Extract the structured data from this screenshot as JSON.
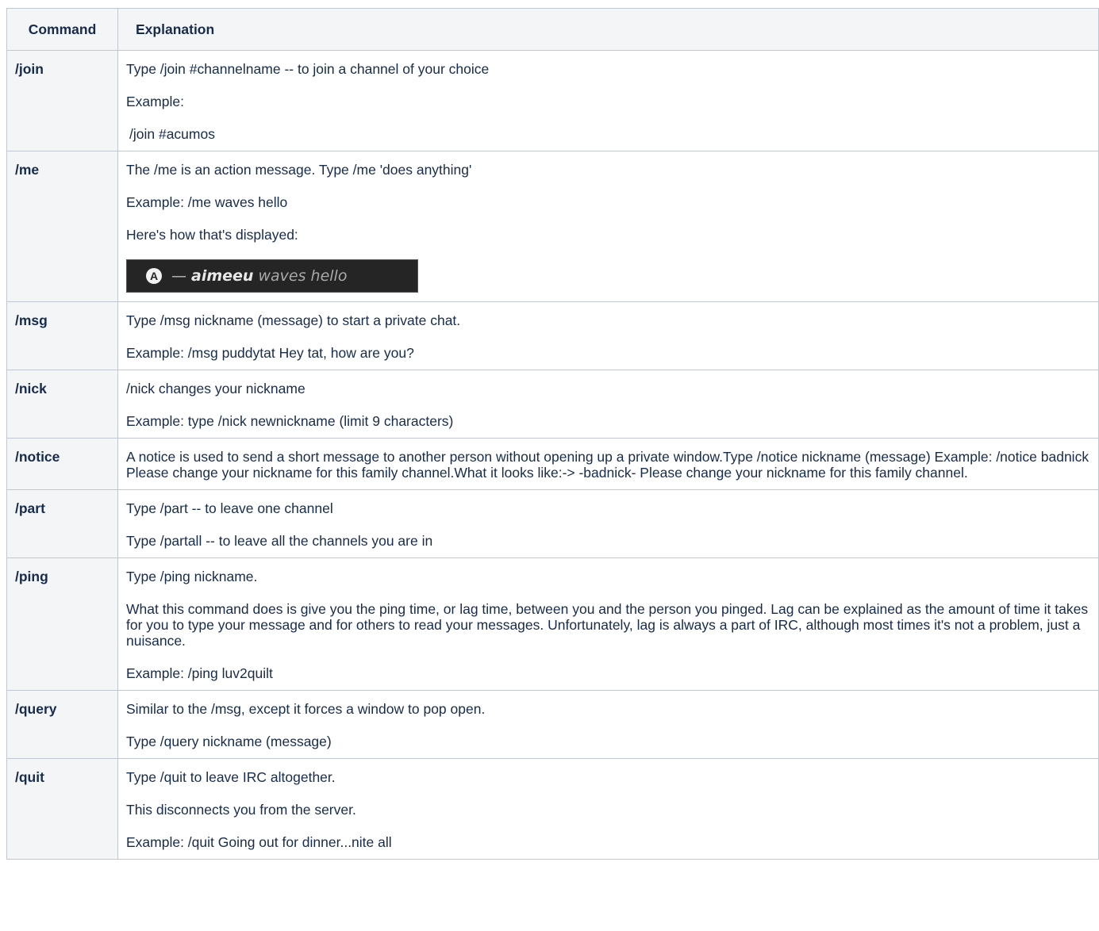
{
  "headers": {
    "command": "Command",
    "explanation": "Explanation"
  },
  "rows": [
    {
      "command": "/join",
      "paras": [
        "Type /join #channelname -- to join a channel of your choice",
        "Example:",
        "/join #acumos"
      ]
    },
    {
      "command": "/me",
      "paras": [
        "The /me is an action message. Type /me 'does anything'",
        "Example: /me waves hello",
        "Here's how that's displayed:"
      ],
      "image": {
        "avatar_letter": "A",
        "dash": "—",
        "nick": "aimeeu",
        "action": "waves hello"
      }
    },
    {
      "command": "/msg",
      "paras": [
        "Type /msg nickname (message) to start a private chat.",
        "Example: /msg puddytat Hey tat, how are you?"
      ]
    },
    {
      "command": "/nick",
      "paras": [
        "/nick changes your nickname",
        "Example: type /nick newnickname (limit 9 characters)"
      ]
    },
    {
      "command": "/notice",
      "paras": [
        "A notice is used to send a short message to another person without opening up a private window.Type /notice nickname (message) Example: /notice badnick Please change your nickname for this family channel.What it looks like:-> -badnick- Please change your nickname for this family channel."
      ]
    },
    {
      "command": "/part",
      "paras": [
        "Type /part -- to leave one channel",
        "Type /partall -- to leave all the channels you are in"
      ]
    },
    {
      "command": "/ping",
      "paras": [
        "Type /ping nickname.",
        "What this command does is give you the ping time, or lag time, between you and the person you pinged. Lag can be explained as the amount of time it takes for you to type your message and for others to read your messages. Unfortunately, lag is always a part of IRC, although most times it's not a problem, just a nuisance.",
        "Example: /ping luv2quilt"
      ]
    },
    {
      "command": "/query",
      "paras": [
        "Similar to the /msg, except it forces a window to pop open.",
        "Type /query nickname (message)"
      ]
    },
    {
      "command": "/quit",
      "paras": [
        "Type /quit to leave IRC altogether.",
        "This disconnects you from the server.",
        "Example: /quit Going out for dinner...nite all"
      ]
    }
  ]
}
